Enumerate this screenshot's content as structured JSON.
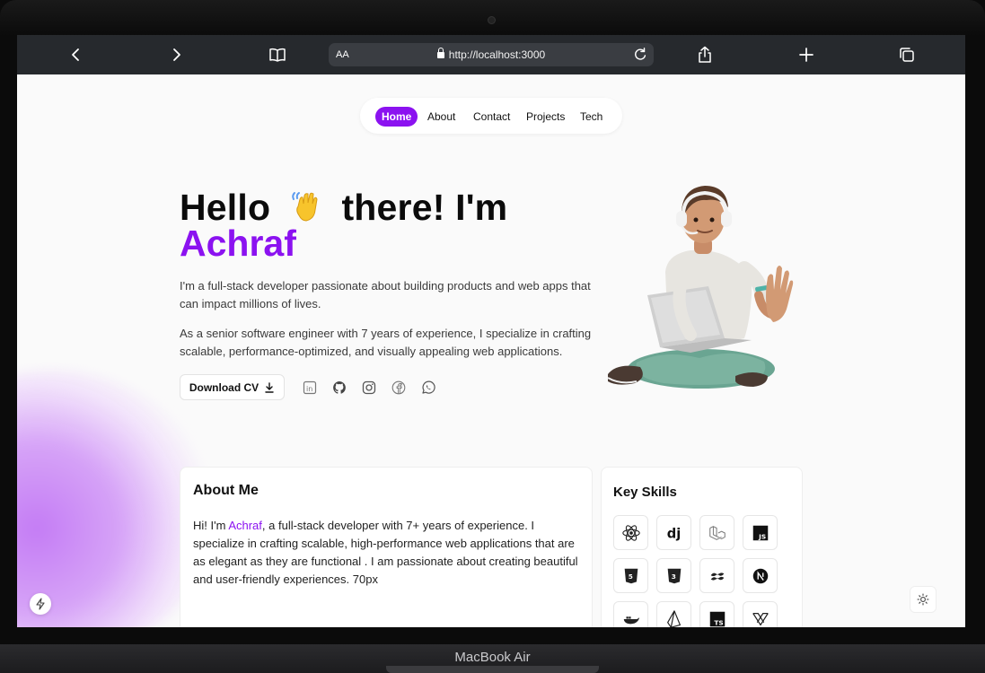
{
  "device": {
    "label": "MacBook Air"
  },
  "browser": {
    "text_size_label": "AA",
    "url": "http://localhost:3000"
  },
  "nav": {
    "items": [
      {
        "label": "Home",
        "active": true
      },
      {
        "label": "About",
        "active": false
      },
      {
        "label": "Contact",
        "active": false
      },
      {
        "label": "Projects",
        "active": false
      },
      {
        "label": "Tech",
        "active": false
      }
    ]
  },
  "hero": {
    "greeting_before": "Hello",
    "greeting_after": "there! I'm",
    "name": "Achraf",
    "paragraph1": "I'm a full-stack developer passionate about building products and web apps that can impact millions of lives.",
    "paragraph2": "As a senior software engineer with 7 years of experience, I specialize in crafting scalable, performance-optimized, and visually appealing web applications.",
    "cv_button": "Download CV",
    "socials": [
      "linkedin-icon",
      "github-icon",
      "instagram-icon",
      "facebook-icon",
      "whatsapp-icon"
    ]
  },
  "about": {
    "title": "About Me",
    "text_before": "Hi! I'm ",
    "name": "Achraf",
    "text_after": ", a full-stack developer with 7+ years of experience. I specialize in crafting scalable, high-performance web applications that are as elegant as they are functional . I am passionate about creating beautiful and user-friendly experiences. 70px"
  },
  "skills": {
    "title": "Key Skills",
    "icons": [
      "react-icon",
      "django-icon",
      "laravel-icon",
      "javascript-icon",
      "html5-icon",
      "css3-icon",
      "tailwind-icon",
      "nextjs-icon",
      "docker-icon",
      "prisma-icon",
      "typescript-icon",
      "framer-icon"
    ]
  },
  "colors": {
    "accent": "#8b12f0"
  }
}
